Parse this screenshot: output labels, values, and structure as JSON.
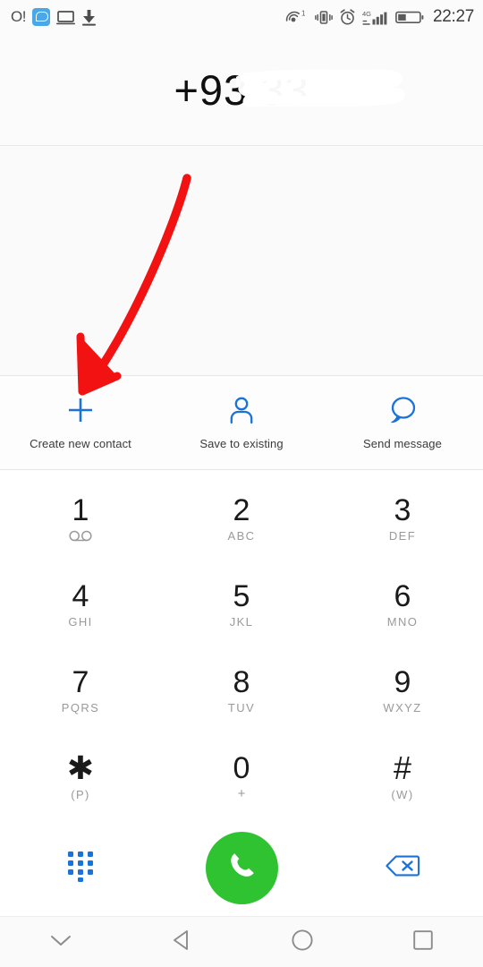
{
  "status_bar": {
    "left_text": "O!",
    "icons_left": [
      "chat-app-icon",
      "monitor-icon",
      "download-icon"
    ],
    "icons_right": [
      "hotspot-icon",
      "vibrate-icon",
      "alarm-icon",
      "signal-4g-icon",
      "battery-icon"
    ],
    "hotspot_superscript": "1",
    "network_label": "4G",
    "time": "22:27"
  },
  "number_display": {
    "value": "+93 33",
    "redacted": true,
    "note": "remaining digits obscured by white redaction scribble"
  },
  "actions": [
    {
      "label": "Create new contact",
      "icon": "plus-icon"
    },
    {
      "label": "Save to existing",
      "icon": "person-icon"
    },
    {
      "label": "Send message",
      "icon": "speech-bubble-icon"
    }
  ],
  "keypad": {
    "rows": [
      [
        {
          "digit": "1",
          "sub": "",
          "sub_icon": "voicemail-icon"
        },
        {
          "digit": "2",
          "sub": "ABC",
          "sub_icon": ""
        },
        {
          "digit": "3",
          "sub": "DEF",
          "sub_icon": ""
        }
      ],
      [
        {
          "digit": "4",
          "sub": "GHI",
          "sub_icon": ""
        },
        {
          "digit": "5",
          "sub": "JKL",
          "sub_icon": ""
        },
        {
          "digit": "6",
          "sub": "MNO",
          "sub_icon": ""
        }
      ],
      [
        {
          "digit": "7",
          "sub": "PQRS",
          "sub_icon": ""
        },
        {
          "digit": "8",
          "sub": "TUV",
          "sub_icon": ""
        },
        {
          "digit": "9",
          "sub": "WXYZ",
          "sub_icon": ""
        }
      ],
      [
        {
          "digit": "✱",
          "sub": "(P)",
          "sub_icon": ""
        },
        {
          "digit": "0",
          "sub": "+",
          "sub_icon": ""
        },
        {
          "digit": "#",
          "sub": "(W)",
          "sub_icon": ""
        }
      ]
    ]
  },
  "bottom_actions": {
    "dialpad_icon": "dialpad-dots-icon",
    "call_icon": "phone-handset-icon",
    "backspace_icon": "backspace-delete-icon"
  },
  "nav_bar": {
    "items": [
      {
        "icon": "chevron-down-icon",
        "name": "hide-keyboard"
      },
      {
        "icon": "back-triangle-icon",
        "name": "back"
      },
      {
        "icon": "home-circle-icon",
        "name": "home"
      },
      {
        "icon": "recents-square-icon",
        "name": "recents"
      }
    ]
  },
  "annotation": {
    "type": "red-arrow",
    "color": "#f21212",
    "points_to": "Create new contact"
  },
  "colors": {
    "accent_blue": "#1b72d9",
    "call_green": "#2fc231",
    "annotation_red": "#f21212",
    "background": "#fbfbfb",
    "text_primary": "#1a1a1a",
    "text_secondary": "#9a9a9a"
  }
}
